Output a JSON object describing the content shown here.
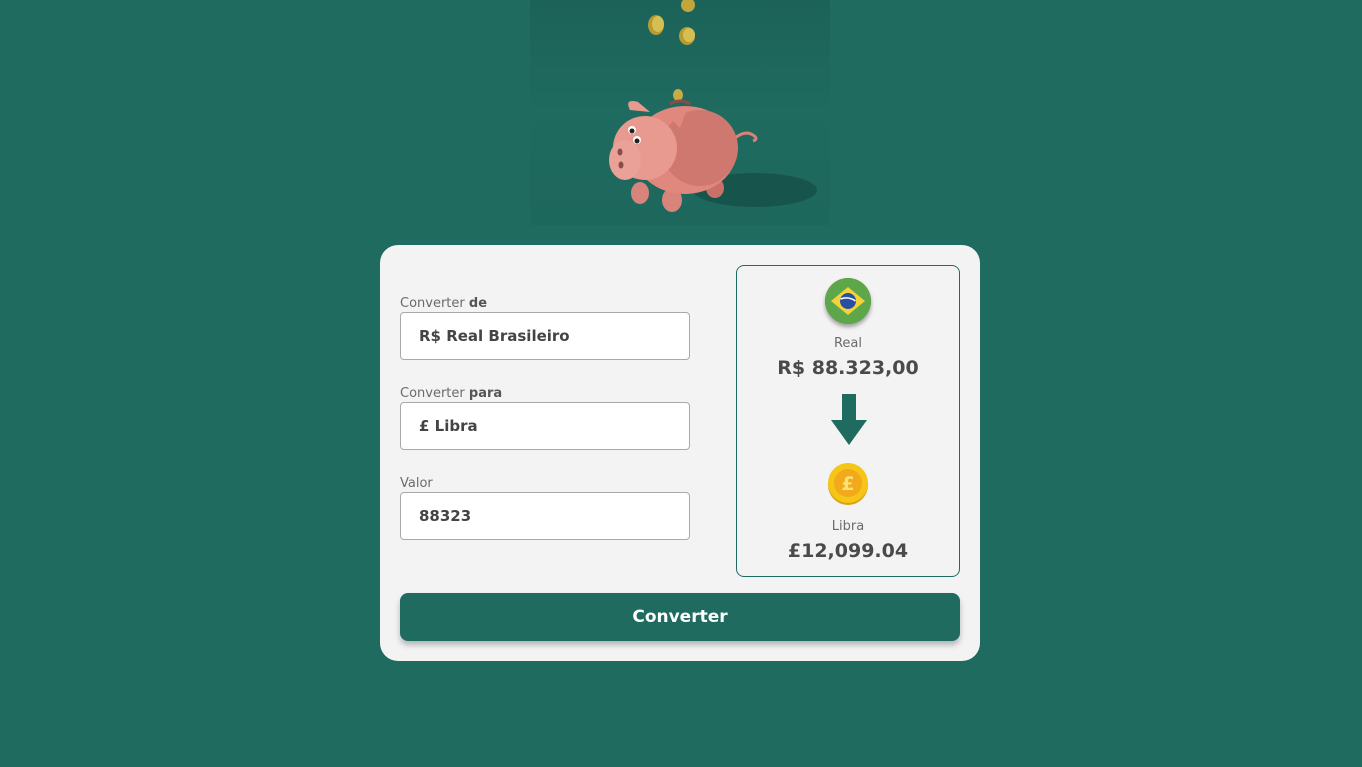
{
  "converter": {
    "from_label_prefix": "Converter ",
    "from_label_bold": "de",
    "from_value": "R$ Real Brasileiro",
    "to_label_prefix": "Converter ",
    "to_label_bold": "para",
    "to_value": "£ Libra",
    "amount_label": "Valor",
    "amount_value": "88323",
    "button_label": "Converter"
  },
  "result": {
    "from_name": "Real",
    "from_amount": "R$ 88.323,00",
    "to_name": "Libra",
    "to_amount": "£12,099.04",
    "coin_symbol": "£"
  },
  "icons": {
    "hero": "piggy-bank-illustration",
    "from": "brazil-flag-icon",
    "arrow": "arrow-down-icon",
    "to": "pound-coin-icon"
  },
  "colors": {
    "background": "#1f6b5f",
    "card": "#f3f3f3",
    "accent": "#1f6b5f"
  }
}
